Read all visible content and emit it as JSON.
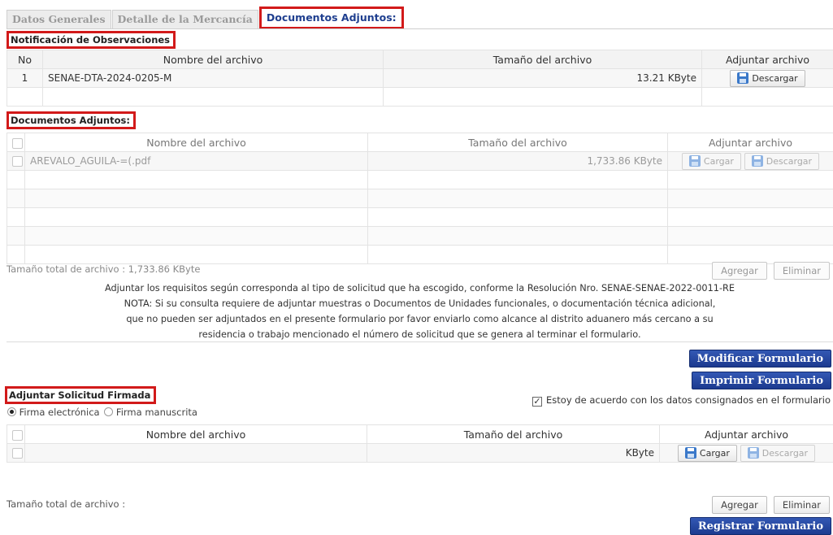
{
  "tabs": [
    "Datos Generales",
    "Detalle de la Mercancía",
    "Documentos Adjuntos:"
  ],
  "notificacion": {
    "title": "Notificación de Observaciones",
    "headers": {
      "no": "No",
      "nombre": "Nombre del archivo",
      "tamano": "Tamaño del archivo",
      "adjuntar": "Adjuntar archivo"
    },
    "rows": [
      {
        "no": "1",
        "nombre": "SENAE-DTA-2024-0205-M",
        "tamano": "13.21 KByte",
        "descargar": "Descargar"
      }
    ]
  },
  "documentos": {
    "title": "Documentos Adjuntos:",
    "headers": {
      "nombre": "Nombre del archivo",
      "tamano": "Tamaño del archivo",
      "adjuntar": "Adjuntar archivo"
    },
    "rows": [
      {
        "nombre": "AREVALO_AGUILA-=(.pdf",
        "tamano": "1,733.86 KByte",
        "cargar": "Cargar",
        "descargar": "Descargar"
      }
    ],
    "total": "Tamaño total de archivo : 1,733.86 KByte",
    "agregar": "Agregar",
    "eliminar": "Eliminar"
  },
  "note": [
    "Adjuntar los requisitos según corresponda al tipo de solicitud que ha escogido, conforme la Resolución Nro. SENAE-SENAE-2022-0011-RE",
    "NOTA: Si su consulta requiere de adjuntar muestras o Documentos de Unidades funcionales, o documentación técnica adicional,",
    "que no pueden ser adjuntados en el presente formulario por favor enviarlo como alcance al distrito aduanero más cercano a su",
    "residencia o trabajo mencionado el número de solicitud que se genera al terminar el formulario."
  ],
  "actions": {
    "modificar": "Modificar Formulario",
    "imprimir": "Imprimir Formulario",
    "acuerdo": "Estoy de acuerdo con los datos consignados en el formulario",
    "acuerdo_checked": true
  },
  "solicitud": {
    "title": "Adjuntar Solicitud Firmada",
    "firma_electronica": "Firma electrónica",
    "firma_manuscrita": "Firma manuscrita",
    "selected": "Firma electrónica",
    "headers": {
      "nombre": "Nombre del archivo",
      "tamano": "Tamaño del archivo",
      "adjuntar": "Adjuntar archivo"
    },
    "rows": [
      {
        "nombre": "",
        "tamano": "KByte",
        "cargar": "Cargar",
        "descargar": "Descargar"
      }
    ],
    "total": "Tamaño total de archivo :",
    "agregar": "Agregar",
    "eliminar": "Eliminar",
    "registrar": "Registrar Formulario"
  },
  "colors": {
    "accent": "#1f3f8f",
    "highlight": "#d21a1a",
    "button_blue": "#24449c"
  }
}
